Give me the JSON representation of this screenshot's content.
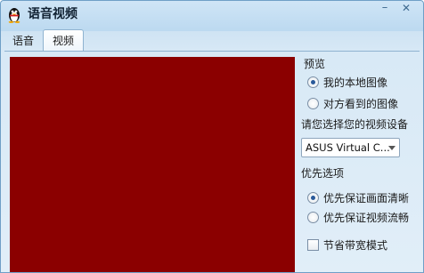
{
  "window": {
    "title": "语音视频"
  },
  "titlebar": {
    "minimize_symbol": "–",
    "close_symbol": "✕",
    "icon": "qq-penguin-icon"
  },
  "tabs": [
    {
      "label": "语音",
      "active": false
    },
    {
      "label": "视频",
      "active": true
    }
  ],
  "video": {
    "background_color": "#8b0000"
  },
  "preview": {
    "heading": "预览",
    "options": [
      {
        "label": "我的本地图像",
        "selected": true
      },
      {
        "label": "对方看到的图像",
        "selected": false
      }
    ]
  },
  "device": {
    "heading": "请您选择您的视频设备",
    "selected": "ASUS Virtual C..."
  },
  "priority": {
    "heading": "优先选项",
    "options": [
      {
        "label": "优先保证画面清晰",
        "selected": true
      },
      {
        "label": "优先保证视频流畅",
        "selected": false
      }
    ]
  },
  "bandwidth": {
    "label": "节省带宽模式",
    "checked": false
  }
}
